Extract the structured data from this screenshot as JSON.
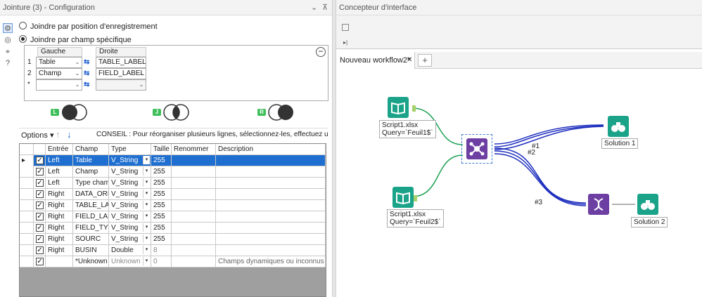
{
  "left_panel": {
    "title": "Jointure (3) - Configuration",
    "pin": "⊼",
    "options": [
      "Joindre par position d'enregistrement",
      "Joindre par champ spécifique"
    ],
    "field_grid": {
      "headers": [
        "Gauche",
        "Droite"
      ],
      "rows": [
        {
          "num": "1",
          "left": "Table",
          "right": "TABLE_LABEL"
        },
        {
          "num": "2",
          "left": "Champ",
          "right": "FIELD_LABEL"
        },
        {
          "num": "*",
          "left": "",
          "right": ""
        }
      ]
    },
    "venn": [
      "L",
      "J",
      "R"
    ],
    "options_button": "Options",
    "tip": "CONSEIL : Pour réorganiser plusieurs lignes, sélectionnez-les, effectuez un clic droit et faites-les",
    "table": {
      "headers": [
        "Entrée",
        "Champ",
        "Type",
        "Taille",
        "Renommer",
        "Description"
      ],
      "rows": [
        {
          "input": "Left",
          "field": "Table",
          "type": "V_String",
          "size": "255",
          "rename": "",
          "desc": ""
        },
        {
          "input": "Left",
          "field": "Champ",
          "type": "V_String",
          "size": "255",
          "rename": "",
          "desc": ""
        },
        {
          "input": "Left",
          "field": "Type champ",
          "type": "V_String",
          "size": "255",
          "rename": "",
          "desc": ""
        },
        {
          "input": "Right",
          "field": "DATA_ORI...",
          "type": "V_String",
          "size": "255",
          "rename": "",
          "desc": ""
        },
        {
          "input": "Right",
          "field": "TABLE_LAB...",
          "type": "V_String",
          "size": "255",
          "rename": "",
          "desc": ""
        },
        {
          "input": "Right",
          "field": "FIELD_LABEL",
          "type": "V_String",
          "size": "255",
          "rename": "",
          "desc": ""
        },
        {
          "input": "Right",
          "field": "FIELD_TYPE",
          "type": "V_String",
          "size": "255",
          "rename": "",
          "desc": ""
        },
        {
          "input": "Right",
          "field": "SOURC",
          "type": "V_String",
          "size": "255",
          "rename": "",
          "desc": ""
        },
        {
          "input": "Right",
          "field": "BUSIN",
          "type": "Double",
          "size": "8",
          "rename": "",
          "desc": ""
        },
        {
          "input": "",
          "field": "*Unknown",
          "type": "Unknown",
          "size": "0",
          "rename": "",
          "desc": "Champs dynamiques ou inconnus"
        }
      ]
    }
  },
  "right_panel": {
    "title": "Concepteur d'interface",
    "tab": "Nouveau workflow2*",
    "tab_close": "✕",
    "tab_add": "+",
    "canvas": {
      "input1": [
        "Script1.xlsx",
        "Query=`Feuil1$`"
      ],
      "input2": [
        "Script1.xlsx",
        "Query=`Feuil2$`"
      ],
      "out1": "Solution 1",
      "out2": "Solution 2",
      "labels": [
        "#1",
        "#2",
        "#3"
      ]
    }
  },
  "colors": {
    "accent": "#1f6fd1",
    "green_tool": "#1aa389",
    "purple_tool": "#6d3fa3"
  }
}
